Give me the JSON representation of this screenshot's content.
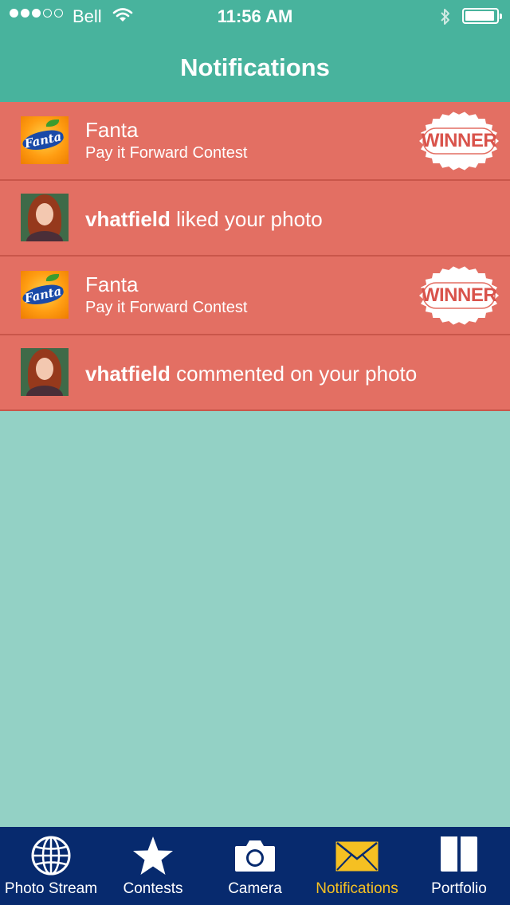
{
  "status_bar": {
    "carrier": "Bell",
    "time": "11:56 AM",
    "signal_bars_filled": 3,
    "signal_bars_total": 5,
    "battery_level": 0.95
  },
  "header": {
    "title": "Notifications"
  },
  "notifications": [
    {
      "type": "contest",
      "brand": "Fanta",
      "subtitle": "Pay it Forward Contest",
      "badge": "WINNER",
      "icon": "fanta-logo"
    },
    {
      "type": "activity",
      "user": "vhatfield",
      "action": "liked your photo",
      "icon": "user-avatar"
    },
    {
      "type": "contest",
      "brand": "Fanta",
      "subtitle": "Pay it Forward Contest",
      "badge": "WINNER",
      "icon": "fanta-logo"
    },
    {
      "type": "activity",
      "user": "vhatfield",
      "action": "commented on your photo",
      "icon": "user-avatar"
    }
  ],
  "tabbar": {
    "active": "notifications",
    "tabs": [
      {
        "id": "photo-stream",
        "label": "Photo Stream",
        "icon": "globe-icon"
      },
      {
        "id": "contests",
        "label": "Contests",
        "icon": "star-icon"
      },
      {
        "id": "camera",
        "label": "Camera",
        "icon": "camera-icon"
      },
      {
        "id": "notifications",
        "label": "Notifications",
        "icon": "envelope-icon"
      },
      {
        "id": "portfolio",
        "label": "Portfolio",
        "icon": "book-icon"
      }
    ]
  },
  "colors": {
    "header": "#48b39d",
    "background": "#93d1c5",
    "row": "#e36f63",
    "tabbar": "#072a6e",
    "active_tab": "#f5c022"
  }
}
